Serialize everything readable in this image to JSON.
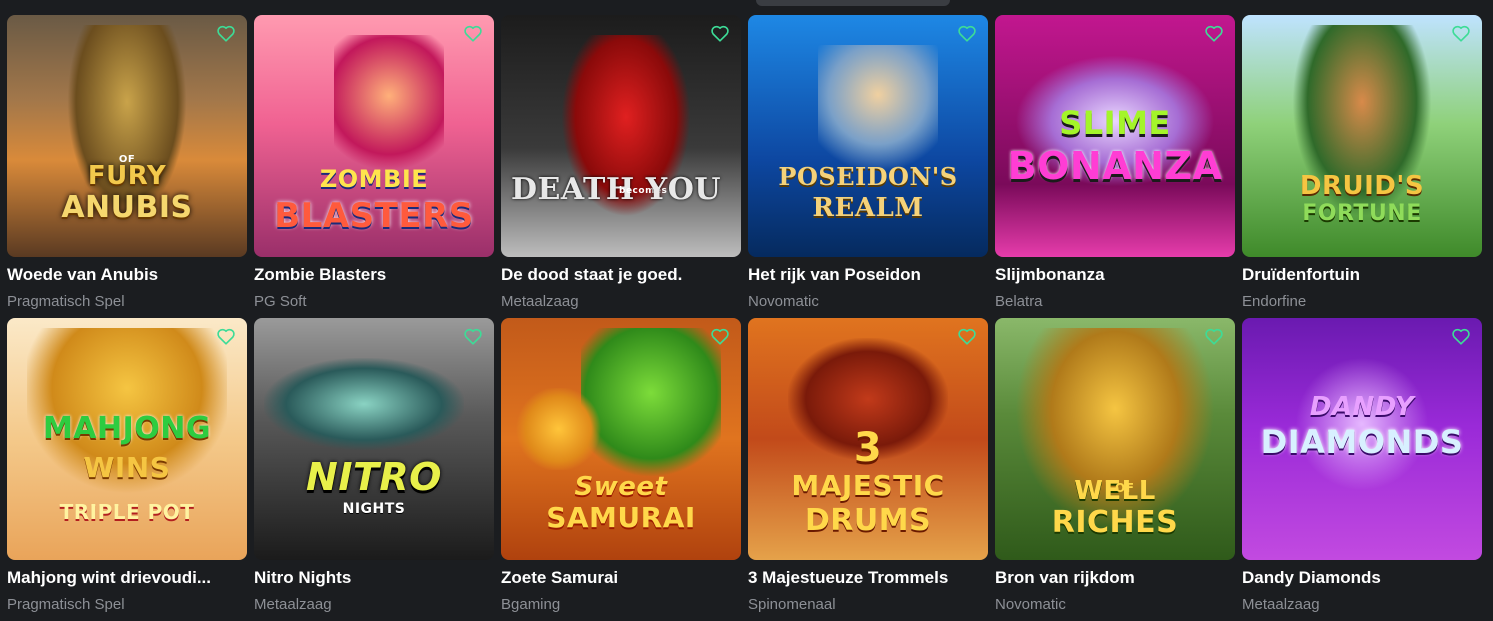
{
  "games": [
    {
      "title": "Woede van Anubis",
      "provider": "Pragmatisch Spel",
      "logo_line1": "FURY",
      "logo_small": "OF",
      "logo_line2": "ANUBIS",
      "icon": "anubis-art"
    },
    {
      "title": "Zombie Blasters",
      "provider": "PG Soft",
      "logo_line1": "ZOMBIE",
      "logo_small": "",
      "logo_line2": "BLASTERS",
      "icon": "zombie-art"
    },
    {
      "title": "De dood staat je goed.",
      "provider": "Metaalzaag",
      "logo_line1": "DEATH",
      "logo_small": "becomes",
      "logo_line2": "YOU",
      "icon": "heart-art"
    },
    {
      "title": "Het rijk van Poseidon",
      "provider": "Novomatic",
      "logo_line1": "POSEIDON'S",
      "logo_small": "",
      "logo_line2": "REALM",
      "icon": "poseidon-art"
    },
    {
      "title": "Slijmbonanza",
      "provider": "Belatra",
      "logo_line1": "SLIME",
      "logo_small": "",
      "logo_line2": "BONANZA",
      "icon": "ufo-art"
    },
    {
      "title": "Druïdenfortuin",
      "provider": "Endorfine",
      "logo_line1": "DRUID'S",
      "logo_small": "",
      "logo_line2": "FORTUNE",
      "icon": "druid-art"
    },
    {
      "title": "Mahjong wint drievoudi...",
      "provider": "Pragmatisch Spel",
      "logo_line1": "MAHJONG",
      "logo_small": "WINS",
      "logo_line2": "TRIPLE POT",
      "icon": "dragon-art"
    },
    {
      "title": "Nitro Nights",
      "provider": "Metaalzaag",
      "logo_line1": "NITRO",
      "logo_small": "",
      "logo_line2": "NIGHTS",
      "icon": "car-art"
    },
    {
      "title": "Zoete Samurai",
      "provider": "Bgaming",
      "logo_line1": "Sweet",
      "logo_small": "",
      "logo_line2": "SAMURAI",
      "icon": "broccoli-art"
    },
    {
      "title": "3 Majestueuze Trommels",
      "provider": "Spinomenaal",
      "logo_line1": "3",
      "logo_small": "MAJESTIC",
      "logo_line2": "DRUMS",
      "icon": "drum-art"
    },
    {
      "title": "Bron van rijkdom",
      "provider": "Novomatic",
      "logo_line1": "WELL",
      "logo_small": "OF",
      "logo_line2": "RICHES",
      "icon": "well-art"
    },
    {
      "title": "Dandy Diamonds",
      "provider": "Metaalzaag",
      "logo_line1": "DANDY",
      "logo_small": "",
      "logo_line2": "DIAMONDS",
      "icon": "diamond-art"
    }
  ],
  "colors": {
    "favorite_icon": "#3ddc97",
    "background": "#1b1d20",
    "provider_text": "#8d9096"
  }
}
